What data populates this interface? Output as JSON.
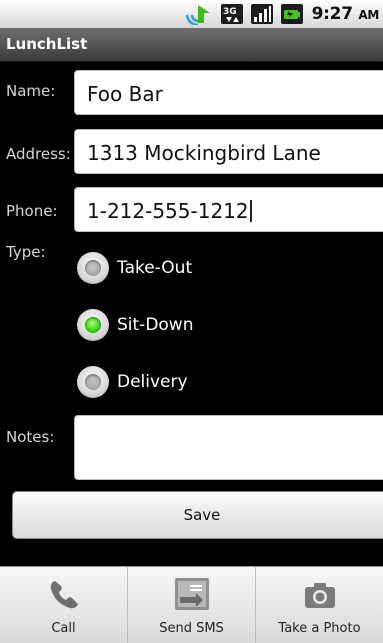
{
  "status_bar": {
    "time": "9:27",
    "time_suffix": "AM",
    "network_label": "3G",
    "icons": [
      "sync-icon",
      "3g-icon",
      "signal-icon",
      "battery-icon"
    ]
  },
  "title_bar": {
    "title": "LunchList"
  },
  "form": {
    "name": {
      "label": "Name:",
      "value": "Foo Bar"
    },
    "address": {
      "label": "Address:",
      "value": "1313 Mockingbird Lane"
    },
    "phone": {
      "label": "Phone:",
      "value": "1-212-555-1212"
    },
    "type": {
      "label": "Type:",
      "options": [
        {
          "label": "Take-Out",
          "checked": false
        },
        {
          "label": "Sit-Down",
          "checked": true
        },
        {
          "label": "Delivery",
          "checked": false
        }
      ]
    },
    "notes": {
      "label": "Notes:",
      "value": ""
    },
    "save_label": "Save"
  },
  "options_menu": {
    "items": [
      {
        "label": "Call",
        "icon": "phone-icon"
      },
      {
        "label": "Send SMS",
        "icon": "sms-icon"
      },
      {
        "label": "Take a Photo",
        "icon": "camera-icon"
      }
    ]
  },
  "colors": {
    "background": "#000000",
    "field_background": "#ffffff",
    "radio_checked": "#36d318",
    "label_text": "#d6d6d6"
  }
}
